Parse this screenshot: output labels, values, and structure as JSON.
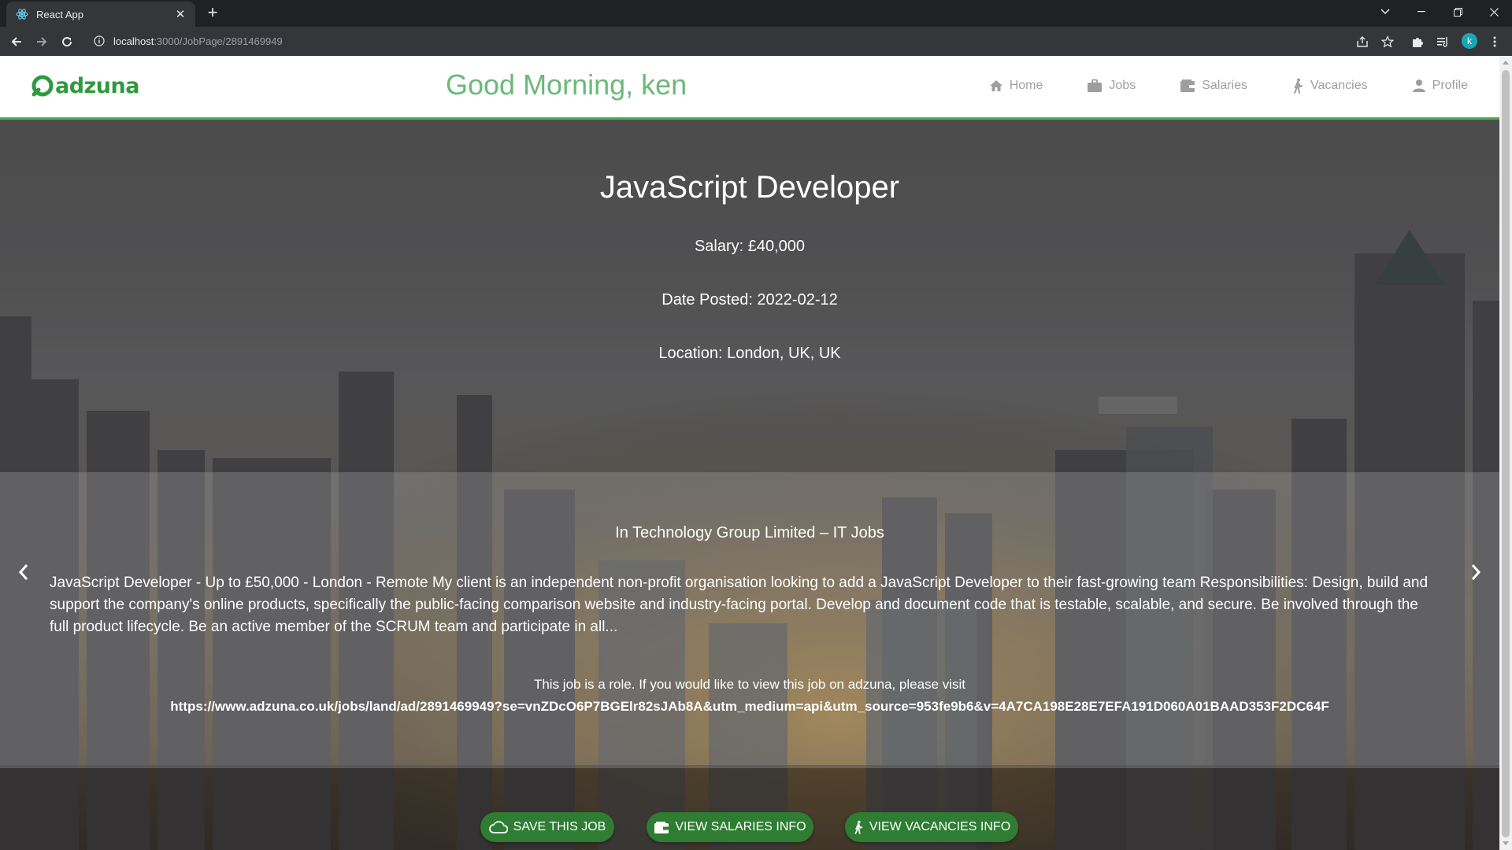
{
  "browser": {
    "tab_title": "React App",
    "tab_close": "✕",
    "new_tab": "+",
    "url_host": "localhost",
    "url_path": ":3000/JobPage/2891469949",
    "avatar_letter": "k"
  },
  "header": {
    "logo_text": "adzuna",
    "greeting": "Good Morning, ken",
    "nav": [
      {
        "label": "Home",
        "icon": "home-icon"
      },
      {
        "label": "Jobs",
        "icon": "briefcase-icon"
      },
      {
        "label": "Salaries",
        "icon": "wallet-icon"
      },
      {
        "label": "Vacancies",
        "icon": "person-walking-icon"
      },
      {
        "label": "Profile",
        "icon": "person-icon"
      }
    ]
  },
  "job": {
    "title": "JavaScript Developer",
    "salary": "Salary: £40,000",
    "date_posted": "Date Posted: 2022-02-12",
    "location": "Location: London, UK, UK",
    "company": "In Technology Group Limited – IT Jobs",
    "description": "JavaScript Developer - Up to £50,000 - London - Remote My client is an independent non-profit organisation looking to add a JavaScript Developer to their fast-growing team Responsibilities: Design, build and support the company's online products, specifically the public-facing comparison website and industry-facing portal. Develop and document code that is testable, scalable, and secure. Be involved through the full product lifecycle. Be an active member of the SCRUM team and participate in all...",
    "visit_text": "This job is a role. If you would like to view this job on adzuna, please visit",
    "visit_url": "https://www.adzuna.co.uk/jobs/land/ad/2891469949?se=vnZDcO6P7BGElr82sJAb8A&utm_medium=api&utm_source=953fe9b6&v=4A7CA198E28E7EFA191D060A01BAAD353F2DC64F"
  },
  "actions": {
    "save": "SAVE THIS JOB",
    "salaries": "VIEW SALARIES INFO",
    "vacancies": "VIEW VACANCIES INFO"
  },
  "colors": {
    "brand_green": "#2e9a3f",
    "button_green": "#2e7d32",
    "nav_grey": "#9e9e9e"
  }
}
